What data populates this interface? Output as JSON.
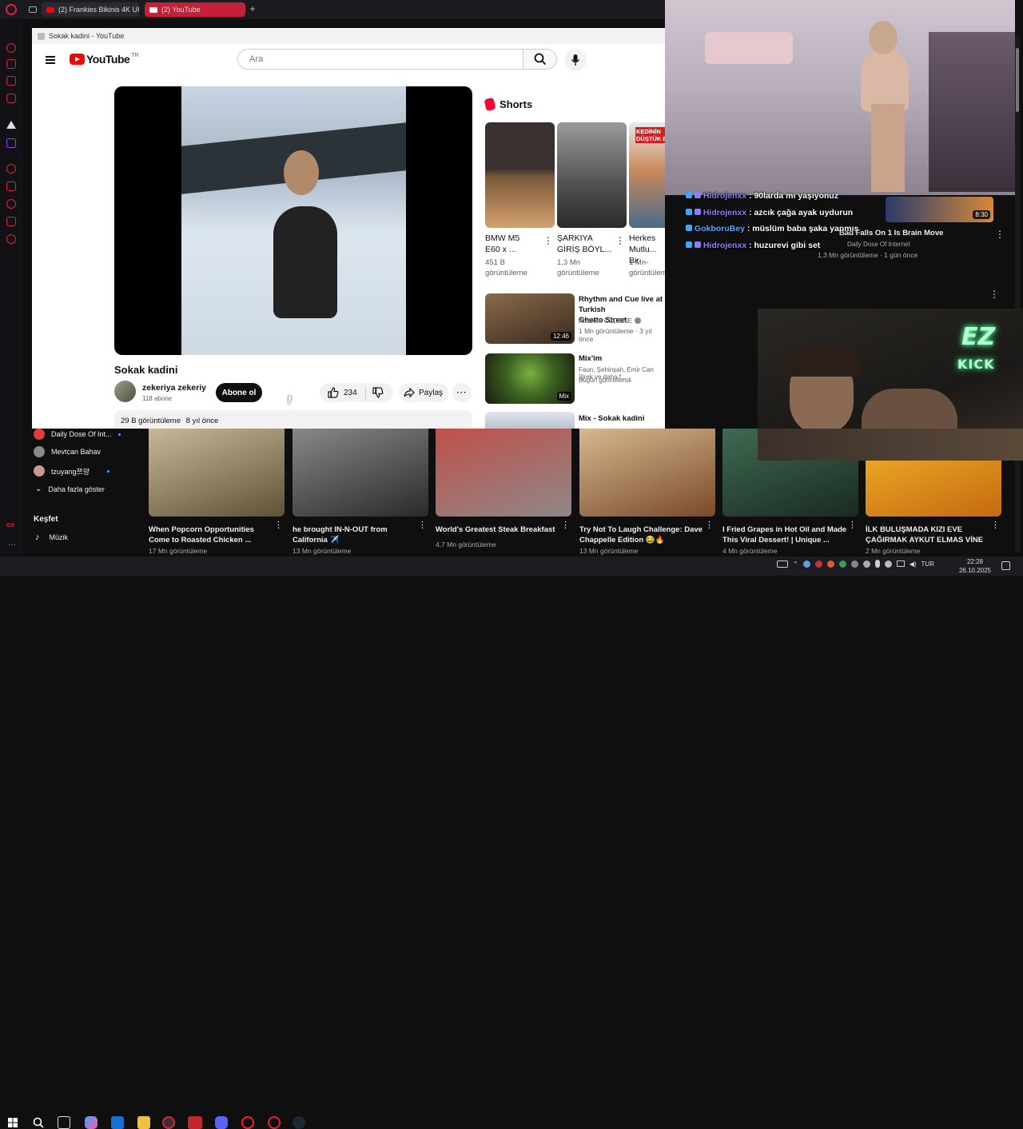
{
  "browser": {
    "tabs": [
      {
        "label": "(2) Frankies Bikinis 4K UH"
      },
      {
        "label": "(2) YouTube"
      }
    ]
  },
  "popup": {
    "window_title": "Sokak kadini - YouTube",
    "logo_text": "YouTube",
    "logo_region": "TR",
    "search": {
      "placeholder": "Ara"
    },
    "video": {
      "title": "Sokak kadini",
      "channel": "zekeriya zekeriy",
      "subscribers": "118 abone",
      "subscribe_label": "Abone ol",
      "likes": "234",
      "share_label": "Paylaş",
      "views": "29 B görüntüleme",
      "age": "8 yıl önce"
    },
    "shorts": {
      "heading": "Shorts",
      "items": [
        {
          "title1": "BMW M5",
          "title2": "E60 x ...",
          "views1": "451 B",
          "views2": "görüntüleme",
          "thumb": "#5a4a44"
        },
        {
          "title1": "ŞARKIYA",
          "title2": "GİRİŞ BÖYL...",
          "views1": "1,3 Mn",
          "views2": "görüntüleme",
          "thumb": "#6a6a6a"
        },
        {
          "title1": "Herkes",
          "title2": "Mutlu... Bir ...",
          "views1": "1 Mn",
          "views2": "görüntüleme",
          "thumb": "#c98a5a",
          "overlay": "KEDİNİN DÜŞTÜK B"
        }
      ]
    },
    "related": [
      {
        "title1": "Rhythm and Cue live at Turkish",
        "title2": "Ghetto Street",
        "channel": "Ataberk ÖZDENE",
        "meta": "1 Mn görüntüleme · 3 yıl önce",
        "duration": "12:46",
        "thumb": "#5b4636"
      },
      {
        "title1": "Mix'im",
        "title2": "",
        "channel": "Faun, Şehinşah, Emir Can İğrek ve daha f...",
        "meta": "Bugün güncellendi",
        "duration": "Mix",
        "thumb": "#3f6b2a"
      },
      {
        "title1": "Mix - Sokak kadini",
        "title2": "",
        "channel": "",
        "meta": "",
        "duration": "",
        "thumb": "#8aa0b8"
      }
    ]
  },
  "stream": {
    "chat": [
      {
        "user": "Hidrojenxx",
        "text": "90larda mı yaşıyonuz"
      },
      {
        "user": "Hidrojenxx",
        "text": "azcık çağa ayak uydurun"
      },
      {
        "user": "GokboruBey",
        "text": "müslüm baba şaka yapmış"
      },
      {
        "user": "Hidrojenxx",
        "text": "huzurevi gibi set"
      }
    ],
    "neon_top": "EZ",
    "neon_bottom": "KICK",
    "bg_video": {
      "title": "Bad Falls On 1 Is Brain Move",
      "channel": "Daily Dose Of Internet",
      "meta": "1,3 Mn görüntüleme · 1 gün önce",
      "duration": "8:30"
    }
  },
  "background_page": {
    "subscriptions": [
      {
        "name": "Daily Dose Of Int...",
        "avatar": "#e23b3b"
      },
      {
        "name": "Mevtcan Bahav",
        "avatar": "#8a8a8a"
      },
      {
        "name": "tzuyang쯔양",
        "avatar": "#c79b8c"
      }
    ],
    "show_more": "Daha fazla göster",
    "explore_heading": "Keşfet",
    "explore_items": [
      {
        "label": "Müzik"
      }
    ],
    "cards": [
      {
        "title1": "When Popcorn Opportunities",
        "title2": "Come to Roasted Chicken ...",
        "meta": "17 Mn görüntüleme",
        "thumb": "#7a6a4a"
      },
      {
        "title1": "he brought IN-N-OUT from",
        "title2": "California ✈️",
        "meta": "13 Mn görüntüleme",
        "thumb": "#555555"
      },
      {
        "title1": "World's Greatest Steak Breakfast",
        "title2": "",
        "meta": "4,7 Mn görüntüleme",
        "thumb": "#a8423f"
      },
      {
        "title1": "Try Not To Laugh Challenge: Dave",
        "title2": "Chappelle Edition 😂🔥",
        "meta": "13 Mn görüntüleme",
        "thumb": "#b07a4a"
      },
      {
        "title1": "I Fried Grapes in Hot Oil and Made",
        "title2": "This Viral Dessert! | Unique ...",
        "meta": "4 Mn görüntüleme",
        "thumb": "#2f4a3a"
      },
      {
        "title1": "İLK BULUŞMADA KIZI EVE",
        "title2": "ÇAĞIRMAK AYKUT ELMAS VİNE",
        "meta": "2 Mn görüntüleme",
        "thumb": "#e8a020"
      }
    ]
  },
  "taskbar": {
    "lang": "TUR",
    "time": "22:28",
    "date": "26.10.2025"
  }
}
